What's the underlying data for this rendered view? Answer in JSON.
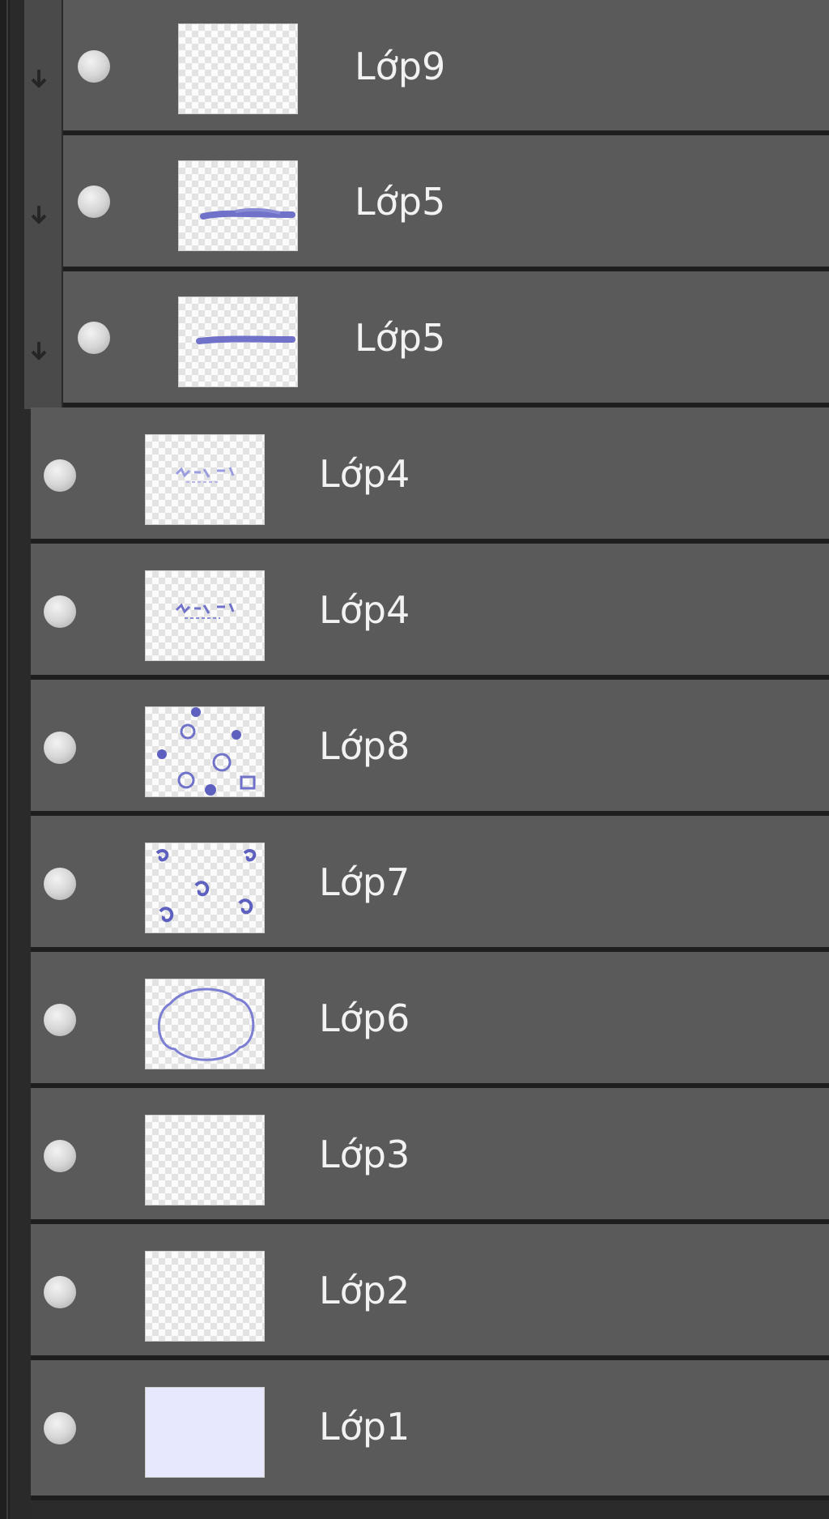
{
  "layers_panel": {
    "layers": [
      {
        "name": "Lớp9",
        "thumbnail": "empty-transparent",
        "clipped": true
      },
      {
        "name": "Lớp5",
        "thumbnail": "blue-stroke",
        "clipped": true
      },
      {
        "name": "Lớp5",
        "thumbnail": "blue-stroke",
        "clipped": true
      },
      {
        "name": "Lớp4",
        "thumbnail": "faint-text",
        "clipped": false
      },
      {
        "name": "Lớp4",
        "thumbnail": "small-text",
        "clipped": false
      },
      {
        "name": "Lớp8",
        "thumbnail": "dots-and-clocks",
        "clipped": false
      },
      {
        "name": "Lớp7",
        "thumbnail": "swirl-doodles",
        "clipped": false
      },
      {
        "name": "Lớp6",
        "thumbnail": "cloud-outline",
        "clipped": false
      },
      {
        "name": "Lớp3",
        "thumbnail": "empty-transparent",
        "clipped": false
      },
      {
        "name": "Lớp2",
        "thumbnail": "empty-transparent",
        "clipped": false
      },
      {
        "name": "Lớp1",
        "thumbnail": "solid-lavender",
        "clipped": false
      }
    ],
    "colors": {
      "row_bg": "#5a5a5a",
      "separator": "#1e1e1e",
      "label_text": "#f2f2f2",
      "stroke_blue": "#6f72c8",
      "lavender_fill": "#e7e7fd"
    }
  }
}
